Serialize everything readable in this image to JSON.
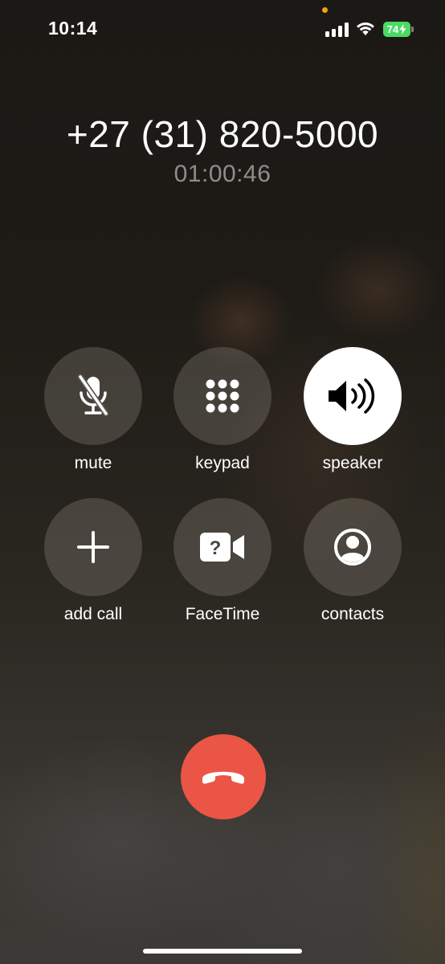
{
  "status_bar": {
    "time": "10:14",
    "battery_level": "74",
    "battery_color": "#4cd964",
    "recording_dot_color": "#ff9f0a",
    "icons": [
      "cellular-signal-icon",
      "wifi-icon",
      "battery-charging-icon"
    ]
  },
  "call": {
    "number": "+27 (31) 820-5000",
    "duration": "01:00:46"
  },
  "buttons": [
    {
      "id": "mute",
      "label": "mute",
      "icon": "mic-slash-icon",
      "active": false
    },
    {
      "id": "keypad",
      "label": "keypad",
      "icon": "keypad-icon",
      "active": false
    },
    {
      "id": "speaker",
      "label": "speaker",
      "icon": "speaker-wave-icon",
      "active": true
    },
    {
      "id": "add-call",
      "label": "add call",
      "icon": "plus-icon",
      "active": false
    },
    {
      "id": "facetime",
      "label": "FaceTime",
      "icon": "video-question-icon",
      "active": false
    },
    {
      "id": "contacts",
      "label": "contacts",
      "icon": "person-circle-icon",
      "active": false
    }
  ],
  "end_call": {
    "icon": "phone-hangup-icon",
    "color": "#eb5545"
  }
}
